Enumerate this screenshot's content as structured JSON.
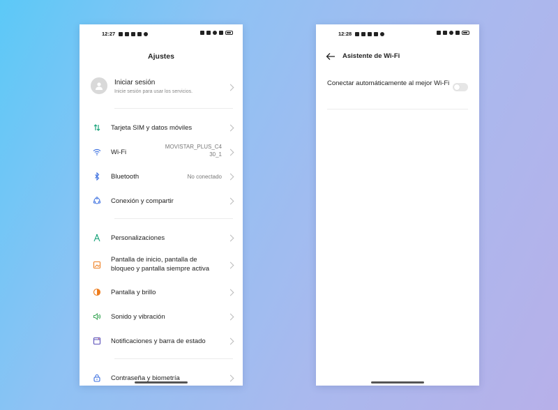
{
  "left_screen": {
    "status_time": "12:27",
    "title": "Ajustes",
    "account": {
      "title": "Iniciar sesión",
      "subtitle": "Inicie sesión para usar los servicios."
    },
    "items": [
      {
        "label": "Tarjeta SIM y datos móviles",
        "value": "",
        "icon": "sim-data-icon",
        "color": "#19a37a"
      },
      {
        "label": "Wi-Fi",
        "value": "MOVISTAR_PLUS_C4 30_1",
        "icon": "wifi-icon",
        "color": "#3b6fe0"
      },
      {
        "label": "Bluetooth",
        "value": "No conectado",
        "icon": "bluetooth-icon",
        "color": "#3b6fe0"
      },
      {
        "label": "Conexión y compartir",
        "value": "",
        "icon": "connection-share-icon",
        "color": "#3b6fe0"
      },
      {
        "label": "Personalizaciones",
        "value": "",
        "icon": "compass-icon",
        "color": "#19a37a"
      },
      {
        "label": "Pantalla de inicio, pantalla de bloqueo y pantalla siempre activa",
        "value": "",
        "icon": "home-screen-icon",
        "color": "#ee7d1e"
      },
      {
        "label": "Pantalla y brillo",
        "value": "",
        "icon": "brightness-icon",
        "color": "#ee7d1e"
      },
      {
        "label": "Sonido y vibración",
        "value": "",
        "icon": "sound-icon",
        "color": "#3aa657"
      },
      {
        "label": "Notificaciones y barra de estado",
        "value": "",
        "icon": "notification-icon",
        "color": "#5a4fb8"
      },
      {
        "label": "Contraseña y biometría",
        "value": "",
        "icon": "lock-icon",
        "color": "#3b6fe0"
      }
    ]
  },
  "right_screen": {
    "status_time": "12:28",
    "title": "Asistente de Wi-Fi",
    "auto_connect_label": "Conectar automáticamente al mejor Wi-Fi",
    "auto_connect_enabled": false
  }
}
